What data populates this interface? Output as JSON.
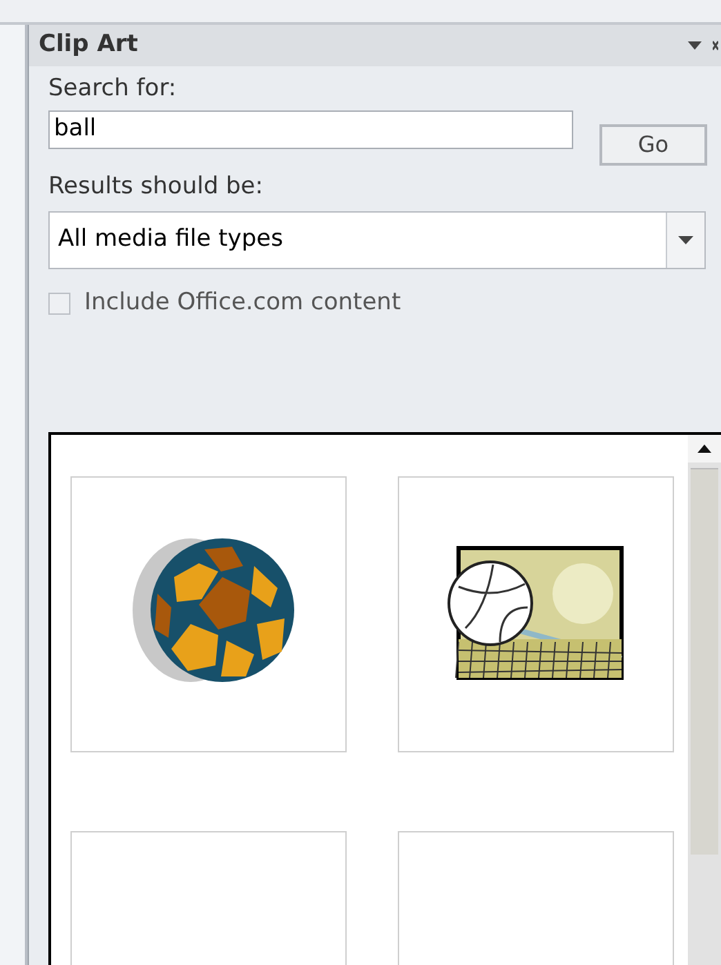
{
  "pane": {
    "title": "Clip Art"
  },
  "search": {
    "label": "Search for:",
    "value": "ball",
    "button": "Go"
  },
  "results_type": {
    "label": "Results should be:",
    "value": "All media file types"
  },
  "include_online": {
    "label": "Include Office.com content",
    "checked": false
  },
  "clips": [
    {
      "kind": "soccer_ball"
    },
    {
      "kind": "volleyball"
    },
    {
      "kind": "blank"
    },
    {
      "kind": "blank"
    }
  ]
}
